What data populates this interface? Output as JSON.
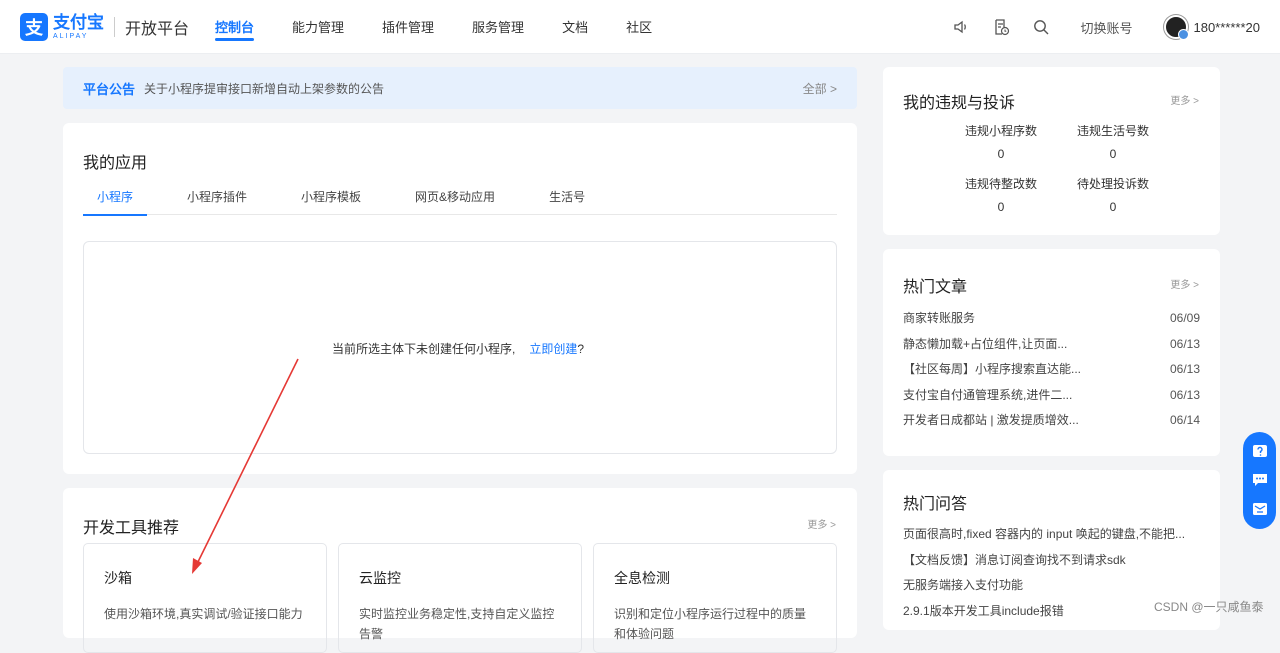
{
  "header": {
    "logo_cn": "支付宝",
    "logo_en": "ALIPAY",
    "logo_mark": "支",
    "platform": "开放平台",
    "nav": [
      {
        "label": "控制台",
        "active": true
      },
      {
        "label": "能力管理"
      },
      {
        "label": "插件管理"
      },
      {
        "label": "服务管理"
      },
      {
        "label": "文档"
      },
      {
        "label": "社区"
      }
    ],
    "icons": [
      "speaker-icon",
      "document-clock-icon",
      "search-icon"
    ],
    "switch_account": "切换账号",
    "username": "180******20"
  },
  "notice": {
    "tag": "平台公告",
    "text": "关于小程序提审接口新增自动上架参数的公告",
    "more": "全部 >"
  },
  "apps": {
    "title": "我的应用",
    "tabs": [
      "小程序",
      "小程序插件",
      "小程序模板",
      "网页&移动应用",
      "生活号"
    ],
    "active_tab": 0,
    "empty_text": "当前所选主体下未创建任何小程序,",
    "create_link": "立即创建",
    "create_suffix": "?"
  },
  "tools": {
    "title": "开发工具推荐",
    "more": "更多 >",
    "items": [
      {
        "name": "沙箱",
        "desc": "使用沙箱环境,真实调试/验证接口能力"
      },
      {
        "name": "云监控",
        "desc": "实时监控业务稳定性,支持自定义监控告警"
      },
      {
        "name": "全息检测",
        "desc": "识别和定位小程序运行过程中的质量和体验问题"
      }
    ]
  },
  "violations": {
    "title": "我的违规与投诉",
    "more": "更多 >",
    "stats": [
      {
        "label": "违规小程序数",
        "value": "0"
      },
      {
        "label": "违规生活号数",
        "value": "0"
      },
      {
        "label": "违规待整改数",
        "value": "0"
      },
      {
        "label": "待处理投诉数",
        "value": "0"
      }
    ]
  },
  "articles": {
    "title": "热门文章",
    "more": "更多 >",
    "items": [
      {
        "title": "商家转账服务",
        "date": "06/09"
      },
      {
        "title": "静态懒加载+占位组件,让页面...",
        "date": "06/13"
      },
      {
        "title": "【社区每周】小程序搜索直达能...",
        "date": "06/13"
      },
      {
        "title": "支付宝自付通管理系统,进件二...",
        "date": "06/13"
      },
      {
        "title": "开发者日成都站 | 激发提质增效...",
        "date": "06/14"
      }
    ]
  },
  "qa": {
    "title": "热门问答",
    "items": [
      "页面很高时,fixed 容器内的 input 唤起的键盘,不能把...",
      "【文档反馈】消息订阅查询找不到请求sdk",
      "无服务端接入支付功能",
      "2.9.1版本开发工具include报错"
    ]
  },
  "float": {
    "icons": [
      "help-icon",
      "chat-icon",
      "feedback-icon"
    ]
  },
  "watermark": "CSDN @一只咸鱼泰",
  "colors": {
    "accent": "#1677ff",
    "arrow": "#e53935",
    "notice_bg": "#e6f0fd"
  }
}
